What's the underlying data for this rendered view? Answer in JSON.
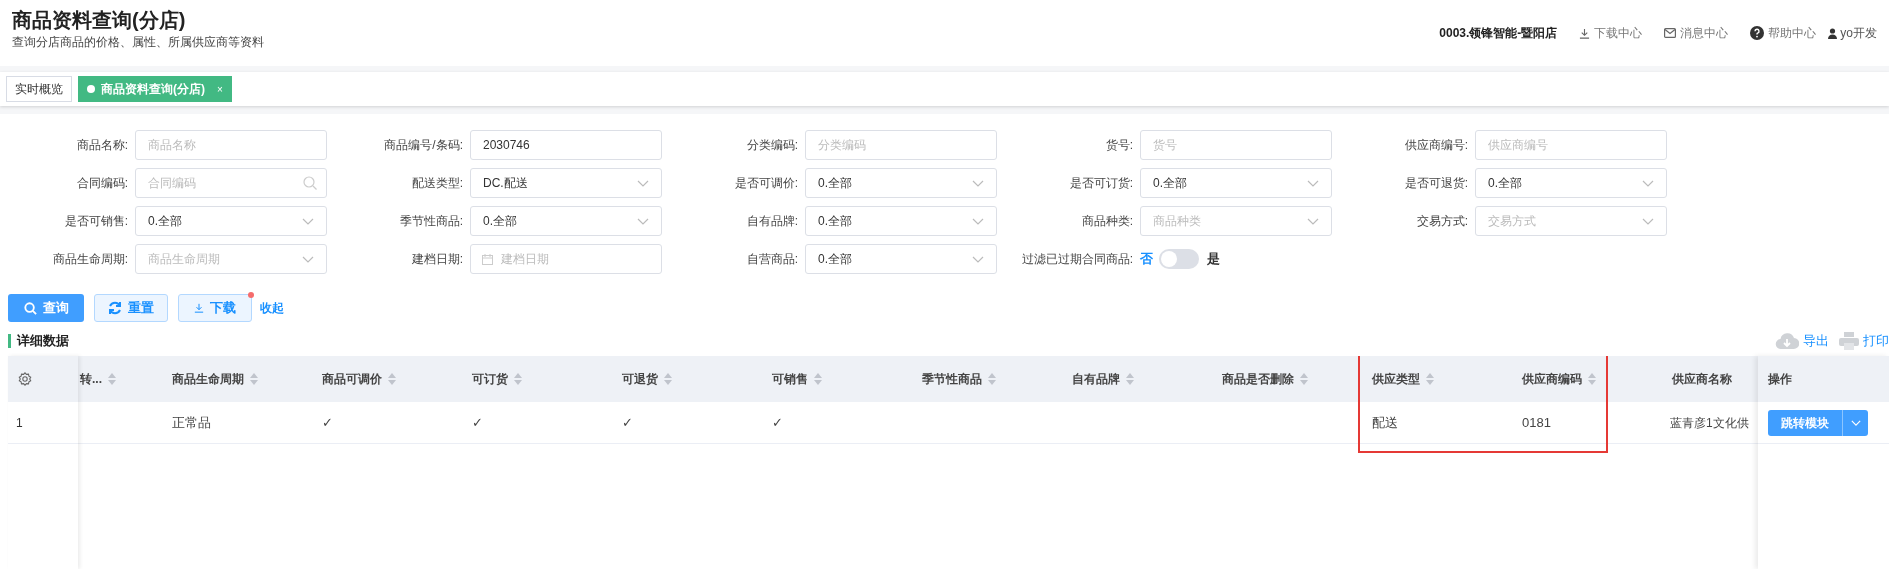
{
  "header": {
    "title": "商品资料查询(分店)",
    "subtitle": "查询分店商品的价格、属性、所属供应商等资料",
    "store": "0003.领锋智能-暨阳店",
    "links": [
      {
        "kind": "download",
        "label": "下载中心"
      },
      {
        "kind": "message",
        "label": "消息中心"
      },
      {
        "kind": "help",
        "label": "帮助中心"
      },
      {
        "kind": "user",
        "label": "yo开发"
      }
    ]
  },
  "tabs": [
    {
      "label": "实时概览",
      "selected": false
    },
    {
      "label": "商品资料查询(分店)",
      "selected": true,
      "close": "×"
    }
  ],
  "filters": [
    {
      "label": "商品名称:",
      "kind": "text",
      "placeholder": "商品名称"
    },
    {
      "label": "商品编号/条码:",
      "kind": "text",
      "value": "2030746"
    },
    {
      "label": "分类编码:",
      "kind": "text",
      "placeholder": "分类编码"
    },
    {
      "label": "货号:",
      "kind": "text",
      "placeholder": "货号"
    },
    {
      "label": "供应商编号:",
      "kind": "text",
      "placeholder": "供应商编号"
    },
    {
      "label": "合同编码:",
      "kind": "search",
      "placeholder": "合同编码"
    },
    {
      "label": "配送类型:",
      "kind": "select",
      "value": "DC.配送"
    },
    {
      "label": "是否可调价:",
      "kind": "select",
      "value": "0.全部"
    },
    {
      "label": "是否可订货:",
      "kind": "select",
      "value": "0.全部"
    },
    {
      "label": "是否可退货:",
      "kind": "select",
      "value": "0.全部"
    },
    {
      "label": "是否可销售:",
      "kind": "select",
      "value": "0.全部"
    },
    {
      "label": "季节性商品:",
      "kind": "select",
      "value": "0.全部"
    },
    {
      "label": "自有品牌:",
      "kind": "select",
      "value": "0.全部"
    },
    {
      "label": "商品种类:",
      "kind": "select",
      "placeholder": "商品种类"
    },
    {
      "label": "交易方式:",
      "kind": "select",
      "placeholder": "交易方式"
    },
    {
      "label": "商品生命周期:",
      "kind": "select",
      "placeholder": "商品生命周期"
    },
    {
      "label": "建档日期:",
      "kind": "date",
      "placeholder": "建档日期"
    },
    {
      "label": "自营商品:",
      "kind": "select",
      "value": "0.全部"
    },
    {
      "label": "过滤已过期合同商品:",
      "kind": "switch",
      "off_label": "否",
      "on_label": "是",
      "on": false
    }
  ],
  "buttons": [
    {
      "kind": "search",
      "label": "查询"
    },
    {
      "kind": "reset",
      "label": "重置"
    },
    {
      "kind": "download",
      "label": "下载",
      "badge": true
    }
  ],
  "collapse_link": "收起",
  "section_title": "详细数据",
  "table_tools": [
    {
      "kind": "export",
      "label": "导出"
    },
    {
      "kind": "print",
      "label": "打印"
    }
  ],
  "table": {
    "columns": [
      {
        "label": "转...",
        "highlighted": false
      },
      {
        "label": "商品生命周期",
        "highlighted": false
      },
      {
        "label": "商品可调价",
        "highlighted": false
      },
      {
        "label": "可订货",
        "highlighted": false
      },
      {
        "label": "可退货",
        "highlighted": false
      },
      {
        "label": "可销售",
        "highlighted": false
      },
      {
        "label": "季节性商品",
        "highlighted": false
      },
      {
        "label": "自有品牌",
        "highlighted": false
      },
      {
        "label": "商品是否删除",
        "highlighted": false
      },
      {
        "label": "供应类型",
        "highlighted": true
      },
      {
        "label": "供应商编码",
        "highlighted": true
      },
      {
        "label": "供应商名称",
        "highlighted": false
      }
    ],
    "rows": [
      {
        "index": "1",
        "cells": [
          "",
          "正常品",
          "✓",
          "✓",
          "✓",
          "✓",
          "",
          "",
          "",
          "配送",
          "0181",
          "蓝青彦1文化供"
        ]
      }
    ],
    "action_column": "操作",
    "row_action": "跳转模块"
  }
}
